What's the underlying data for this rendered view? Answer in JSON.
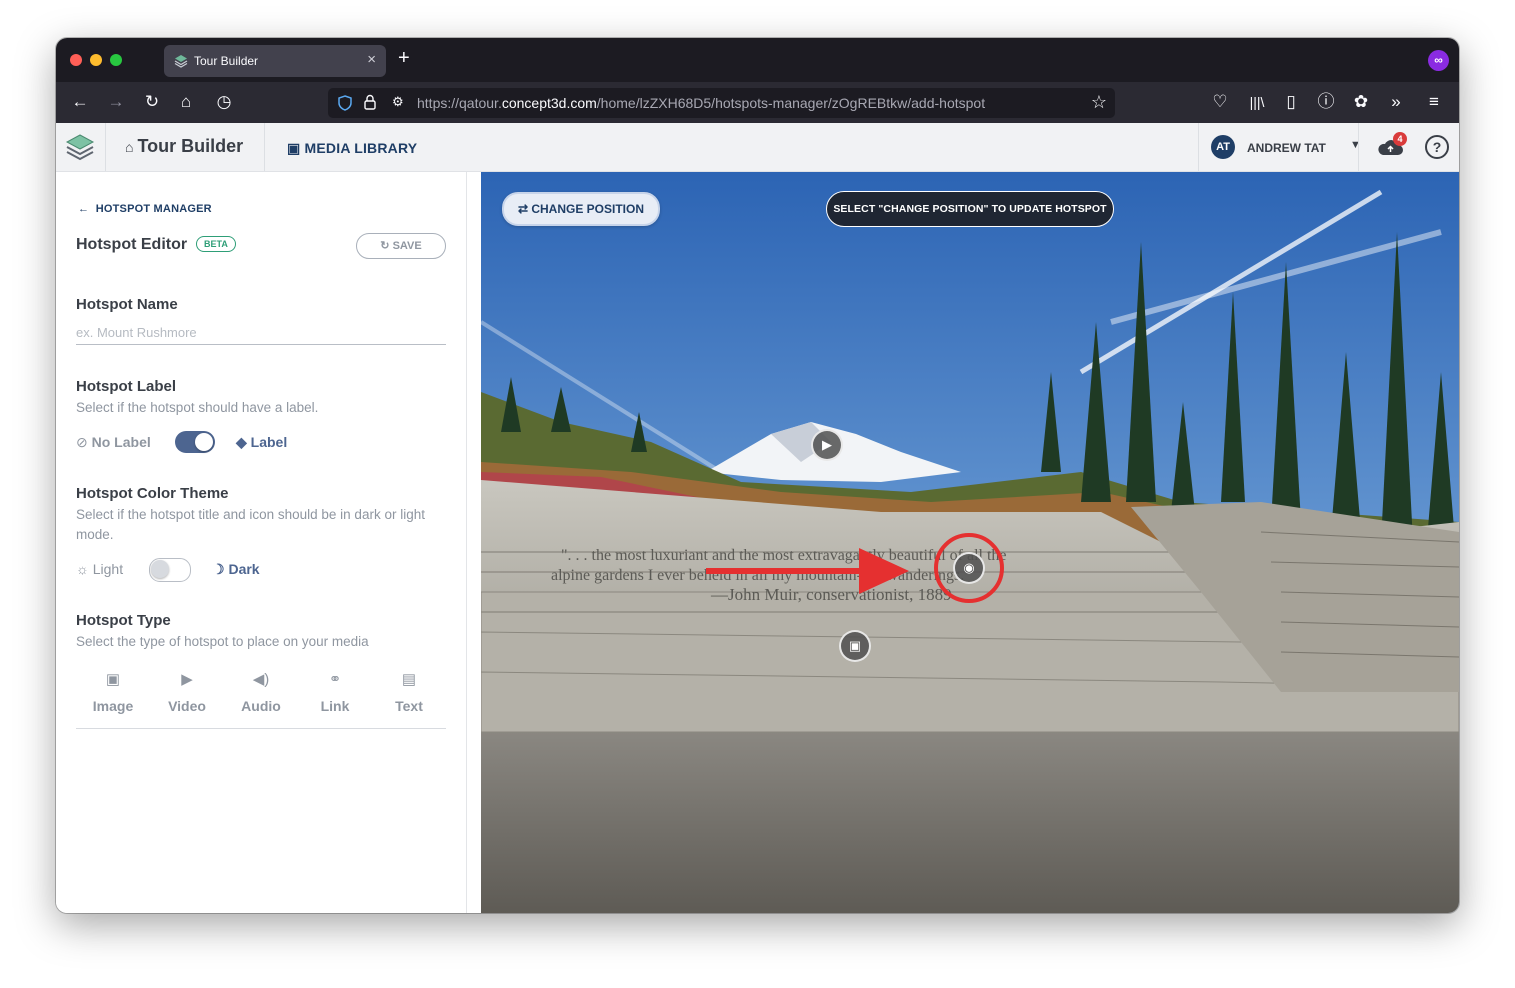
{
  "browser": {
    "tab_title": "Tour Builder",
    "tab_close": "×",
    "new_tab": "+",
    "url_prefix": "https://qatour.",
    "url_domain": "concept3d.com",
    "url_path": "/home/lzZXH68D5/hotspots-manager/zOgREBtkw/add-hotspot",
    "ext_badge": "∞"
  },
  "header": {
    "app_name": "Tour Builder",
    "media_library": "MEDIA LIBRARY",
    "user_initials": "AT",
    "user_name": "ANDREW TAT",
    "notifications": "4",
    "help": "?"
  },
  "sidebar": {
    "back_link": "HOTSPOT MANAGER",
    "editor_title": "Hotspot Editor",
    "beta": "BETA",
    "save": "SAVE",
    "name": {
      "title": "Hotspot Name",
      "placeholder": "ex. Mount Rushmore",
      "value": ""
    },
    "label": {
      "title": "Hotspot Label",
      "desc": "Select if the hotspot should have a label.",
      "off_label": "No Label",
      "on_label": "Label",
      "enabled": true
    },
    "color": {
      "title": "Hotspot Color Theme",
      "desc": "Select if the hotspot title and icon should be in dark or light mode.",
      "light": "Light",
      "dark": "Dark",
      "dark_enabled": false
    },
    "type": {
      "title": "Hotspot Type",
      "desc": "Select the type of hotspot to place on your media",
      "options": [
        {
          "label": "Image",
          "icon": "image-icon"
        },
        {
          "label": "Video",
          "icon": "video-icon"
        },
        {
          "label": "Audio",
          "icon": "audio-icon"
        },
        {
          "label": "Link",
          "icon": "link-icon"
        },
        {
          "label": "Text",
          "icon": "text-icon"
        }
      ]
    }
  },
  "viewer": {
    "change_position": "CHANGE POSITION",
    "instruction": "SELECT \"CHANGE POSITION\" TO UPDATE HOTSPOT",
    "engraving_line1": "\". . . the most luxuriant and the most extravagantly beautiful of all the",
    "engraving_line2": "alpine gardens I ever beheld in all my mountain-top wanderings.\"",
    "engraving_line3": "—John Muir, conservationist, 1889"
  },
  "colors": {
    "brand_navy": "#1f3e66",
    "accent_green": "#2e9e77",
    "toggle_on": "#4d6590",
    "toggle_off": "#c9cdd3",
    "annotation_red": "#e53030"
  }
}
